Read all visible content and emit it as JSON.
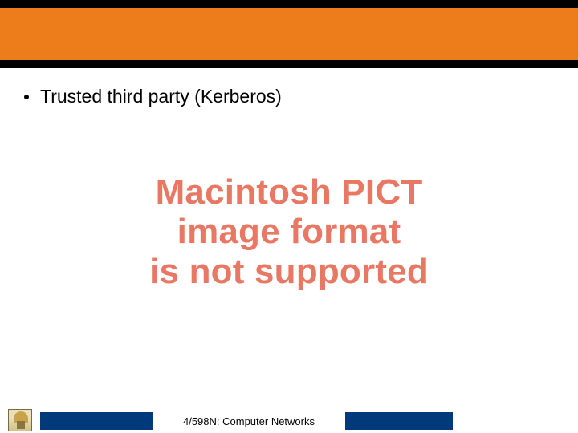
{
  "bullet": {
    "text": "Trusted third party (Kerberos)"
  },
  "pict": {
    "line1": "Macintosh PICT",
    "line2": "image format",
    "line3": "is not supported"
  },
  "footer": {
    "course": "4/598N: Computer Networks"
  }
}
